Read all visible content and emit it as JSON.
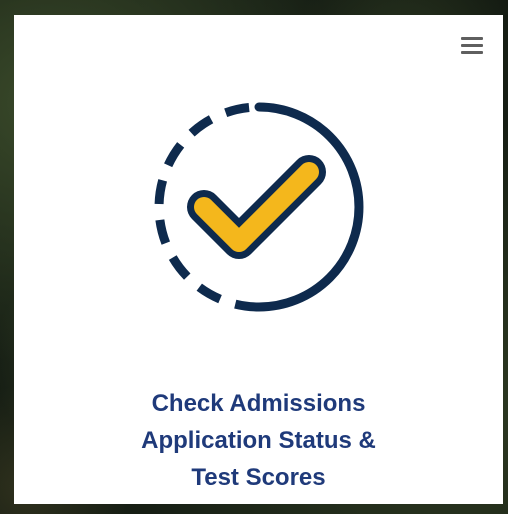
{
  "tile": {
    "title_lines": [
      "Check Admissions",
      "Application Status &",
      "Test Scores"
    ],
    "icon": "dashed-circle-checkmark-icon",
    "menu_icon": "hamburger-menu-icon"
  },
  "colors": {
    "navy": "#0e2a4d",
    "gold": "#f4b71c",
    "title": "#1f3a7a",
    "menu": "#5f5f5f"
  }
}
